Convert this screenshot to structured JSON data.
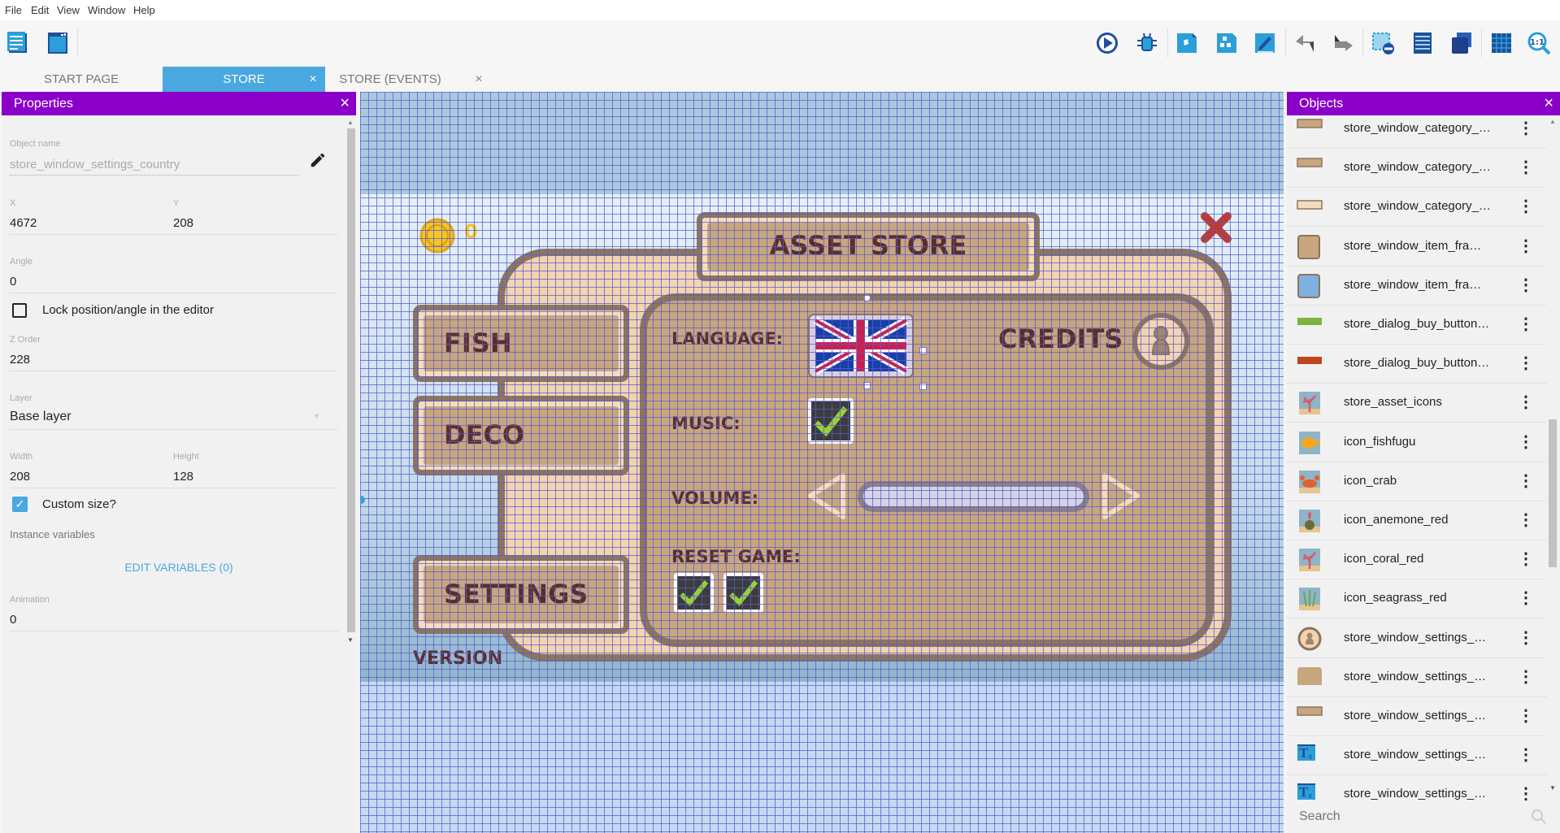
{
  "menu": [
    "File",
    "Edit",
    "View",
    "Window",
    "Help"
  ],
  "toolbar": {
    "left_icons": [
      "project-manager-icon",
      "scene-editor-icon"
    ],
    "right_icons": [
      "preview-play-icon",
      "debug-icon",
      "objects-editor-icon",
      "object-groups-icon",
      "properties-editor-icon",
      "undo-icon",
      "redo-icon",
      "delete-selection-icon",
      "instances-list-icon",
      "layers-icon",
      "grid-icon",
      "zoom-reset-icon"
    ]
  },
  "tabs": [
    {
      "label": "START PAGE",
      "active": false,
      "closable": false
    },
    {
      "label": "STORE",
      "active": true,
      "closable": true
    },
    {
      "label": "STORE (EVENTS)",
      "active": false,
      "closable": true
    }
  ],
  "close_glyph": "×",
  "properties": {
    "title": "Properties",
    "object_name_label": "Object name",
    "object_name": "store_window_settings_country",
    "x_label": "X",
    "x": "4672",
    "y_label": "Y",
    "y": "208",
    "angle_label": "Angle",
    "angle": "0",
    "lock_label": "Lock position/angle in the editor",
    "lock_checked": false,
    "z_label": "Z Order",
    "z": "228",
    "layer_label": "Layer",
    "layer": "Base layer",
    "width_label": "Width",
    "width": "208",
    "height_label": "Height",
    "height": "128",
    "custom_size_label": "Custom size?",
    "custom_size_checked": true,
    "instance_vars_label": "Instance variables",
    "edit_vars": "EDIT VARIABLES (0)",
    "animation_label": "Animation",
    "animation": "0"
  },
  "scene": {
    "coins": "0",
    "title": "Asset store",
    "fish": "Fish",
    "deco": "Deco",
    "settings": "Settings",
    "version": "Version",
    "language": "Language:",
    "credits": "Credits",
    "music": "Music:",
    "volume": "Volume:",
    "reset": "Reset game:",
    "music_checked": true,
    "colors": {
      "panel": "#c8a67e",
      "border": "#8b7560",
      "backdrop": "#f2d4b0",
      "text": "#5a2d2d",
      "grid": "#6a6ad8"
    }
  },
  "objects": {
    "title": "Objects",
    "search_placeholder": "Search",
    "items": [
      {
        "name": "store_window_category_…",
        "icon": "tan-bar"
      },
      {
        "name": "store_window_category_…",
        "icon": "tan-bar"
      },
      {
        "name": "store_window_category_…",
        "icon": "light-bar"
      },
      {
        "name": "store_window_item_fra…",
        "icon": "tan-frame"
      },
      {
        "name": "store_window_item_fra…",
        "icon": "blue-frame"
      },
      {
        "name": "store_dialog_buy_button…",
        "icon": "green-bar"
      },
      {
        "name": "store_dialog_buy_button…",
        "icon": "red-bar"
      },
      {
        "name": "store_asset_icons",
        "icon": "coral"
      },
      {
        "name": "icon_fishfugu",
        "icon": "fish"
      },
      {
        "name": "icon_crab",
        "icon": "crab"
      },
      {
        "name": "icon_anemone_red",
        "icon": "anemone"
      },
      {
        "name": "icon_coral_red",
        "icon": "coral"
      },
      {
        "name": "icon_seagrass_red",
        "icon": "seagrass"
      },
      {
        "name": "store_window_settings_…",
        "icon": "credits-circle"
      },
      {
        "name": "store_window_settings_…",
        "icon": "tan-panel"
      },
      {
        "name": "store_window_settings_…",
        "icon": "tan-bar"
      },
      {
        "name": "store_window_settings_…",
        "icon": "text"
      },
      {
        "name": "store_window_settings_…",
        "icon": "text"
      }
    ]
  }
}
